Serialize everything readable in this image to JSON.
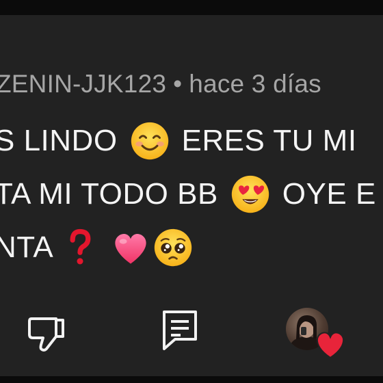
{
  "comment": {
    "author": "ZENIN-JJK123",
    "separator": "•",
    "time": "hace 3 días",
    "lines": [
      {
        "before": "S LINDO",
        "emoji": "smiling-face-with-smiling-eyes",
        "after": "ERES TU MI"
      },
      {
        "before": "TA MI TODO BB",
        "emoji": "smiling-face-with-heart-eyes",
        "after": "OYE E"
      },
      {
        "before": "NTA",
        "emojis": [
          "red-question-mark",
          "pink-heart",
          "pleading-face"
        ]
      }
    ]
  },
  "actions": {
    "dislike_icon": "thumbs-down-icon",
    "reply_icon": "reply-comment-icon",
    "creator_heart": "creator-heart-avatar"
  },
  "colors": {
    "background": "#222222",
    "text": "#f4f4f4",
    "meta": "#a6a6a6",
    "heart": "#e8243a"
  }
}
